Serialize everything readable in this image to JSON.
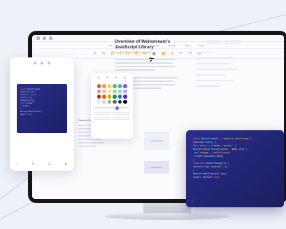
{
  "document": {
    "title": "Overview of Weinstream's JavaScript Library"
  },
  "tabs": [
    "File",
    "Insert",
    "Format",
    "Tools",
    "Review",
    "View",
    "Help"
  ],
  "toolbar_icons": [
    "text-color-icon",
    "highlight-icon",
    "bold-icon",
    "italic-icon",
    "underline-icon",
    "strike-icon",
    "link-icon",
    "image-icon",
    "table-icon",
    "list-icon",
    "undo-icon",
    "redo-icon",
    "comment-icon"
  ],
  "palette": {
    "swatches": [
      "#e9484a",
      "#f0a23a",
      "#f7d154",
      "#49c46e",
      "#3aa7e8",
      "#7a5af2",
      "#f07a7a",
      "#f6c27a",
      "#fbe58f",
      "#8ddda2",
      "#8fcdf3",
      "#b7a3f7",
      "#b52b2d",
      "#c9781a",
      "#c9a81c",
      "#25914a",
      "#1f72b3",
      "#4b2fb5",
      "#ffffff",
      "#d4d6de",
      "#9a9eb0",
      "#5f6377",
      "#2d2f3f",
      "#000000"
    ],
    "accent": "#5b6bff"
  },
  "placeholders": {
    "callout_title": "Overview Content",
    "box1": "File Manager",
    "box2": "Submission"
  },
  "code_card": {
    "lines": [
      {
        "parts": [
          {
            "t": "k",
            "v": "const "
          },
          {
            "t": "n",
            "v": "WeinstreamJS "
          },
          {
            "t": "w",
            "v": "= "
          },
          {
            "t": "s",
            "v": "require('weinstream')"
          }
        ]
      },
      {
        "parts": [
          {
            "t": "w",
            "v": "function "
          },
          {
            "t": "n",
            "v": "init"
          },
          {
            "t": "w",
            "v": "() {"
          }
        ]
      },
      {
        "parts": [
          {
            "t": "w",
            "v": "  let "
          },
          {
            "t": "k",
            "v": "config "
          },
          {
            "t": "w",
            "v": "= { mode: "
          },
          {
            "t": "s",
            "v": "'editor'"
          },
          {
            "t": "w",
            "v": " }"
          }
        ]
      },
      {
        "parts": [
          {
            "t": "n",
            "v": "  WeinstreamJS"
          },
          {
            "t": "w",
            "v": ".setup(config, "
          },
          {
            "t": "s",
            "v": "'#doc-root'"
          },
          {
            "t": "w",
            "v": ")"
          }
        ]
      },
      {
        "parts": [
          {
            "t": "w",
            "v": "    .on("
          },
          {
            "t": "s",
            "v": "'change'"
          },
          {
            "t": "w",
            "v": ", "
          },
          {
            "t": "k",
            "v": "handleChange"
          },
          {
            "t": "w",
            "v": ")"
          }
        ]
      },
      {
        "parts": [
          {
            "t": "w",
            "v": "    .render("
          },
          {
            "t": "n",
            "v": "document.body"
          },
          {
            "t": "w",
            "v": ")"
          }
        ]
      },
      {
        "parts": [
          {
            "t": "w",
            "v": "}"
          }
        ]
      },
      {
        "parts": [
          {
            "t": "w",
            "v": " "
          }
        ]
      },
      {
        "parts": [
          {
            "t": "k",
            "v": "function "
          },
          {
            "t": "n",
            "v": "handleChange"
          },
          {
            "t": "w",
            "v": "(e) {"
          }
        ]
      },
      {
        "parts": [
          {
            "t": "w",
            "v": "  console.log("
          },
          {
            "t": "s",
            "v": "'updated'"
          },
          {
            "t": "w",
            "v": ", e)"
          }
        ]
      },
      {
        "parts": [
          {
            "t": "w",
            "v": "}"
          }
        ]
      },
      {
        "parts": [
          {
            "t": "w",
            "v": " "
          }
        ]
      },
      {
        "parts": [
          {
            "t": "n",
            "v": "  WeinstreamJS"
          },
          {
            "t": "w",
            "v": ".mount("
          },
          {
            "t": "s",
            "v": "'app'"
          },
          {
            "t": "w",
            "v": ")"
          }
        ]
      },
      {
        "parts": [
          {
            "t": "w",
            "v": "  export default "
          },
          {
            "t": "k",
            "v": "init"
          }
        ]
      }
    ]
  },
  "phone_code": {
    "lines": [
      {
        "parts": [
          {
            "t": "k",
            "v": "const "
          },
          {
            "t": "n",
            "v": "WeinstreamJS"
          }
        ]
      },
      {
        "parts": [
          {
            "t": "w",
            "v": "  require("
          },
          {
            "t": "s",
            "v": "'lib'"
          },
          {
            "t": "w",
            "v": ")"
          }
        ]
      },
      {
        "parts": [
          {
            "t": "w",
            "v": "function "
          },
          {
            "t": "n",
            "v": "init"
          },
          {
            "t": "w",
            "v": "()"
          }
        ]
      },
      {
        "parts": [
          {
            "t": "w",
            "v": "  config = {}"
          }
        ]
      },
      {
        "parts": [
          {
            "t": "n",
            "v": "  setup"
          },
          {
            "t": "w",
            "v": "(config)"
          }
        ]
      },
      {
        "parts": [
          {
            "t": "w",
            "v": "  .on("
          },
          {
            "t": "s",
            "v": "'change'"
          },
          {
            "t": "w",
            "v": ")"
          }
        ]
      },
      {
        "parts": [
          {
            "t": "w",
            "v": "  .render()"
          }
        ]
      },
      {
        "parts": [
          {
            "t": "w",
            "v": "}"
          }
        ]
      },
      {
        "parts": [
          {
            "t": "w",
            "v": " "
          }
        ]
      },
      {
        "parts": [
          {
            "t": "n",
            "v": "  WeinstreamJS"
          },
          {
            "t": "w",
            "v": ".mount()"
          }
        ]
      },
      {
        "parts": [
          {
            "t": "w",
            "v": "export "
          },
          {
            "t": "k",
            "v": "init"
          }
        ]
      }
    ]
  },
  "colors": {
    "accent": "#5b6bff",
    "code_bg": "#23287a",
    "keyword": "#ff9a5a",
    "string": "#f7d154"
  }
}
